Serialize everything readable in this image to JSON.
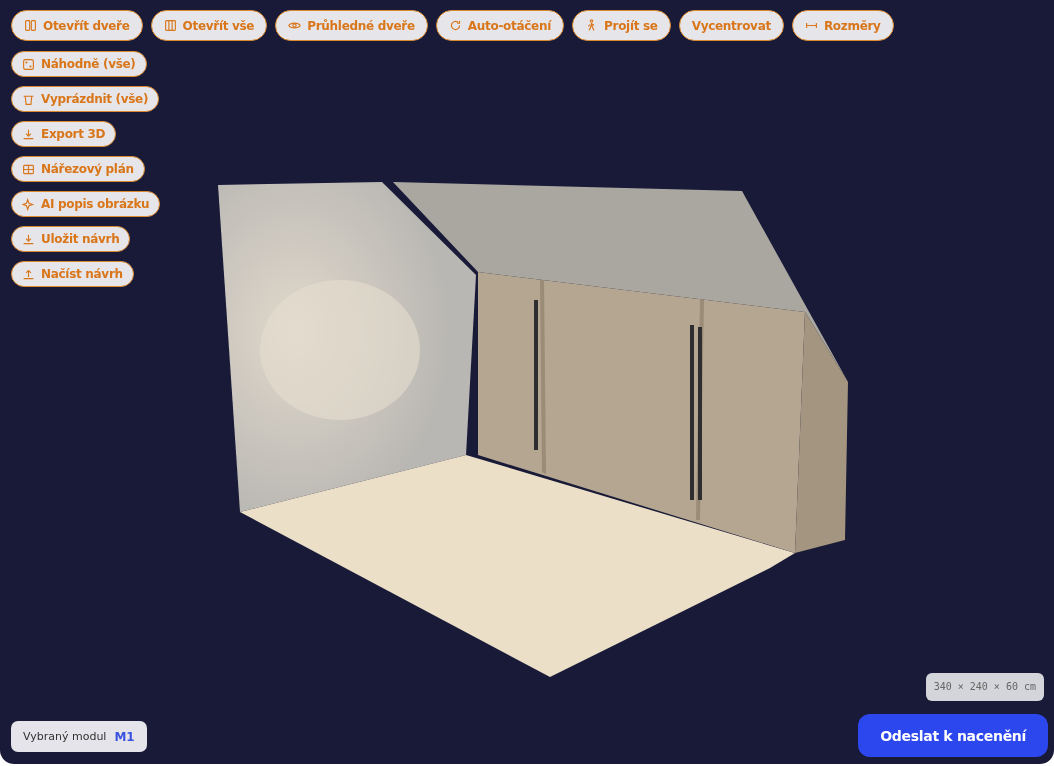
{
  "toolbar": [
    {
      "label": "Otevřít dveře"
    },
    {
      "label": "Otevřít vše"
    },
    {
      "label": "Průhledné dveře"
    },
    {
      "label": "Auto-otáčení"
    },
    {
      "label": "Projít se"
    },
    {
      "label": "Vycentrovat"
    },
    {
      "label": "Rozměry"
    }
  ],
  "side_actions": [
    {
      "label": "Náhodně (vše)"
    },
    {
      "label": "Vyprázdnit (vše)"
    },
    {
      "label": "Export 3D"
    },
    {
      "label": "Nářezový plán"
    },
    {
      "label": "AI popis obrázku"
    },
    {
      "label": "Uložit návrh"
    },
    {
      "label": "Načíst návrh"
    }
  ],
  "selected_module": {
    "label": "Vybraný modul",
    "value": "M1"
  },
  "dimensions": "340 × 240 × 60 cm",
  "submit_button": "Odeslat k nacenění"
}
